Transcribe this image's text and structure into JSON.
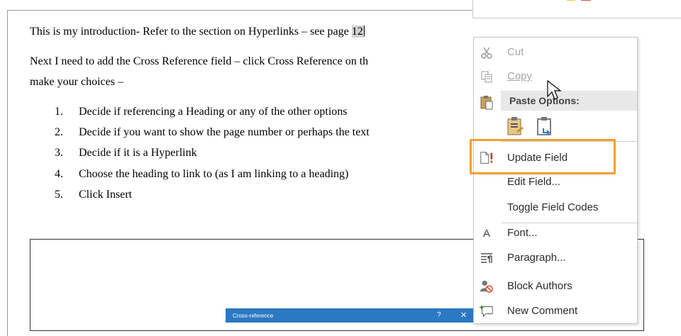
{
  "document": {
    "intro_text": "This is my introduction- Refer to the section on Hyperlinks – see page ",
    "field_value": "12",
    "para2_line1": "Next I need to add the Cross Reference field – click Cross Reference on th",
    "para2_line2": "make your choices –",
    "list": [
      {
        "num": "1.",
        "text": "Decide if referencing a Heading or any of the other options"
      },
      {
        "num": "2.",
        "text": "Decide if you want to show the page number or perhaps the text"
      },
      {
        "num": "3.",
        "text": "Decide if it is a Hyperlink"
      },
      {
        "num": "4.",
        "text": "Choose the heading to link to (as I am linking to a heading)"
      },
      {
        "num": "5.",
        "text": "Click Insert"
      }
    ]
  },
  "dialog": {
    "title": "Cross-reference",
    "help": "?",
    "close": "✕"
  },
  "context_menu": {
    "cut": "Cut",
    "copy": "Copy",
    "paste_options": "Paste Options:",
    "update_field": "Update Field",
    "edit_field": "Edit Field...",
    "toggle_field_codes": "Toggle Field Codes",
    "font": "Font...",
    "font_icon": "A",
    "paragraph": "Paragraph...",
    "block_authors": "Block Authors",
    "new_comment": "New Comment"
  },
  "colors": {
    "highlight_border": "#f0a030",
    "field_shading": "#d4d4d4",
    "dialog_titlebar": "#2b79c2"
  }
}
